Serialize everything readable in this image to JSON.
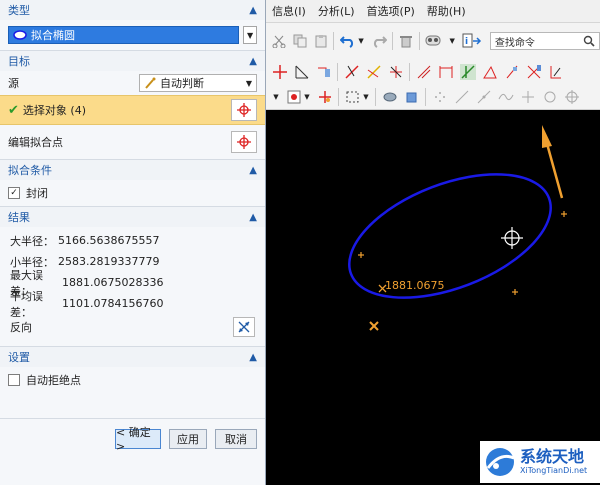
{
  "menu": {
    "items": [
      "信息(I)",
      "分析(L)",
      "首选项(P)",
      "帮助(H)"
    ]
  },
  "toolbar": {
    "search_placeholder": "查找命令"
  },
  "dialog": {
    "type_section": {
      "title": "类型",
      "value": "拟合椭圆"
    },
    "target_section": {
      "title": "目标",
      "source_label": "源",
      "source_value": "自动判断",
      "select_objects": "选择对象 (4)",
      "edit_fit_point": "编辑拟合点"
    },
    "fit_condition_section": {
      "title": "拟合条件",
      "closed_label": "封闭",
      "closed_checked": true
    },
    "result_section": {
      "title": "结果",
      "rows": [
        {
          "label": "大半径：",
          "value": "5166.5638675557"
        },
        {
          "label": "小半径：",
          "value": "2583.2819337779"
        },
        {
          "label": "最大误差：",
          "value": "1881.0675028336"
        },
        {
          "label": "平均误差：",
          "value": "1101.0784156760"
        }
      ],
      "reverse_label": "反向"
    },
    "settings_section": {
      "title": "设置",
      "auto_reject_label": "自动拒绝点",
      "auto_reject_checked": false
    },
    "buttons": {
      "ok": "< 确定 >",
      "apply": "应用",
      "cancel": "取消"
    }
  },
  "viewport": {
    "annotation": "1881.0675",
    "colors": {
      "ellipse": "#1a1ae6",
      "marker": "#f0a030",
      "background": "#000000"
    }
  },
  "watermark": {
    "title": "系统天地",
    "url": "XiTongTianDi.net"
  }
}
